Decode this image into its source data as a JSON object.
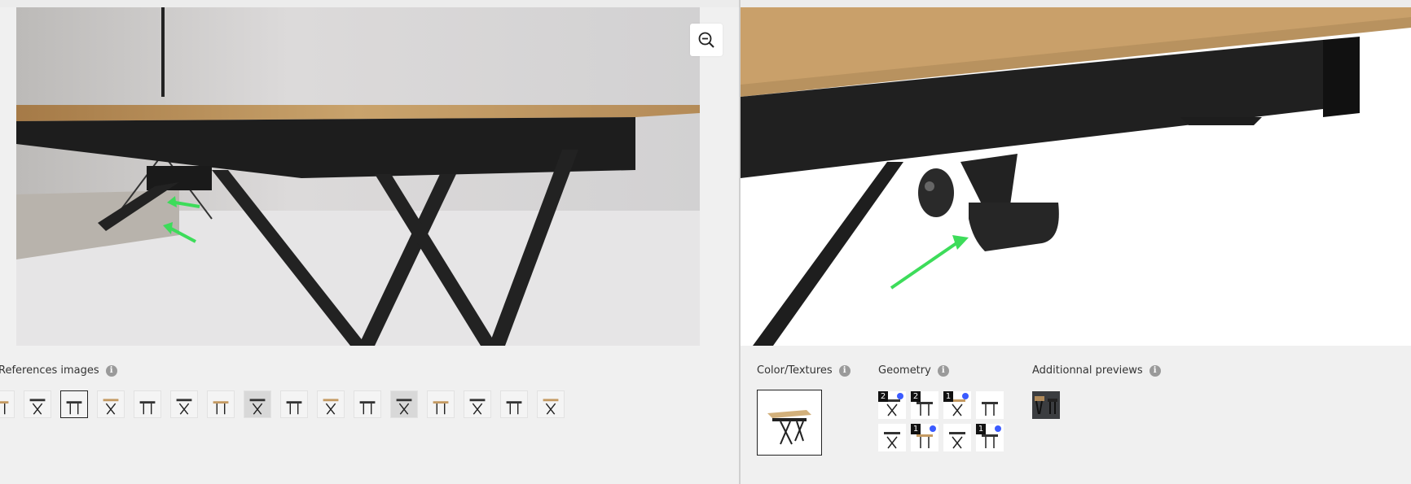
{
  "left": {
    "references_label": "References images",
    "zoom_icon": "zoom-out-icon",
    "thumbnails": [
      {
        "name": "ref-thumb-1",
        "selected": false
      },
      {
        "name": "ref-thumb-2",
        "selected": false
      },
      {
        "name": "ref-thumb-3",
        "selected": true
      },
      {
        "name": "ref-thumb-4",
        "selected": false
      },
      {
        "name": "ref-thumb-5",
        "selected": false
      },
      {
        "name": "ref-thumb-6",
        "selected": false
      },
      {
        "name": "ref-thumb-7",
        "selected": false
      },
      {
        "name": "ref-thumb-8",
        "selected": false
      },
      {
        "name": "ref-thumb-9",
        "selected": false
      },
      {
        "name": "ref-thumb-10",
        "selected": false
      },
      {
        "name": "ref-thumb-11",
        "selected": false
      },
      {
        "name": "ref-thumb-12",
        "selected": false
      },
      {
        "name": "ref-thumb-13",
        "selected": false
      },
      {
        "name": "ref-thumb-14",
        "selected": false
      },
      {
        "name": "ref-thumb-15",
        "selected": false
      },
      {
        "name": "ref-thumb-16",
        "selected": false
      }
    ]
  },
  "right": {
    "color_label": "Color/Textures",
    "geometry_label": "Geometry",
    "previews_label": "Additionnal previews",
    "geometry_tiles": [
      {
        "badge": "2",
        "dot": true
      },
      {
        "badge": "2",
        "dot": false
      },
      {
        "badge": "1",
        "dot": true
      },
      {
        "badge": "",
        "dot": false
      },
      {
        "badge": "",
        "dot": false
      },
      {
        "badge": "1",
        "dot": true
      },
      {
        "badge": "",
        "dot": false
      },
      {
        "badge": "1",
        "dot": true
      }
    ]
  },
  "colors": {
    "accent_arrow": "#3ddc5a",
    "dot": "#3b5bff",
    "wood": "#c49a62",
    "frame": "#1b1b1b"
  }
}
